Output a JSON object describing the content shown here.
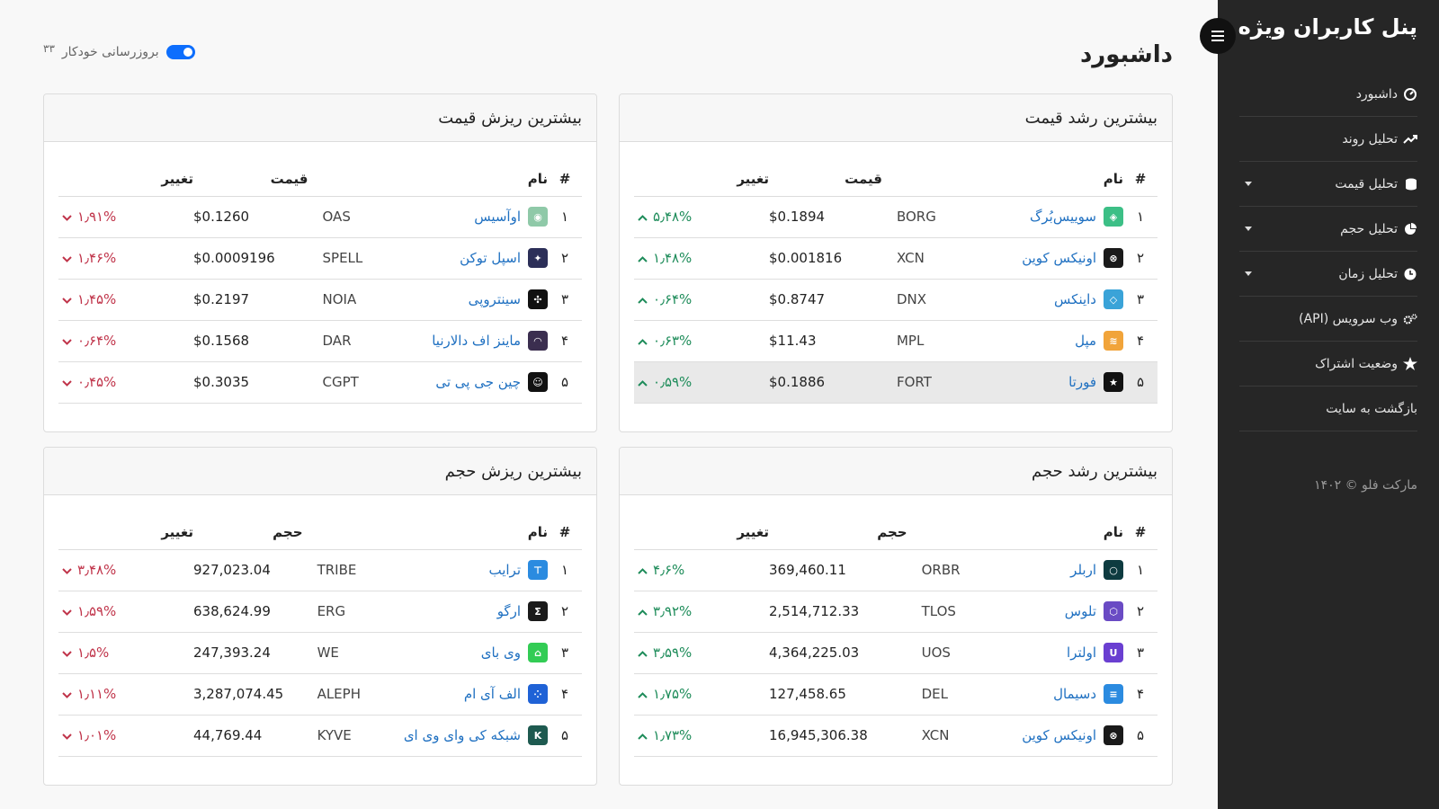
{
  "sidebar": {
    "title": "پنل کاربران ویژه",
    "items": [
      {
        "label": "داشبورد",
        "icon": "dashboard-icon",
        "caret": false
      },
      {
        "label": "تحلیل روند",
        "icon": "trend-icon",
        "caret": false
      },
      {
        "label": "تحلیل قیمت",
        "icon": "coins-icon",
        "caret": true
      },
      {
        "label": "تحلیل حجم",
        "icon": "pie-chart-icon",
        "caret": true
      },
      {
        "label": "تحلیل زمان",
        "icon": "clock-icon",
        "caret": true
      },
      {
        "label": "وب سرویس (API)",
        "icon": "gears-icon",
        "caret": false
      },
      {
        "label": "وضعیت اشتراک",
        "icon": "star-icon",
        "caret": false
      },
      {
        "label": "بازگشت به سایت",
        "icon": "",
        "caret": false
      }
    ],
    "copyright": "مارکت فلو © ۱۴۰۲"
  },
  "header": {
    "title": "داشبورد",
    "auto_refresh_label": "بروزرسانی خودکار",
    "auto_refresh_count": "۳۳",
    "auto_refresh_on": true
  },
  "cards": {
    "price_gainers": {
      "title": "بیشترین رشد قیمت",
      "headers": {
        "idx": "#",
        "name": "نام",
        "value": "قیمت",
        "change": "تغییر"
      },
      "rows": [
        {
          "idx": "۱",
          "name": "سوییس‌بُرگ",
          "symbol": "BORG",
          "value": "$0.1894",
          "change": "۵٫۴۸%",
          "icon_color": "#3cbf86",
          "icon_glyph": "◈"
        },
        {
          "idx": "۲",
          "name": "اونیکس کوین",
          "symbol": "XCN",
          "value": "$0.001816",
          "change": "۱٫۴۸%",
          "icon_color": "#1a1a1a",
          "icon_glyph": "⊗"
        },
        {
          "idx": "۳",
          "name": "داینکس",
          "symbol": "DNX",
          "value": "$0.8747",
          "change": "۰٫۶۴%",
          "icon_color": "#3aa3d8",
          "icon_glyph": "◇"
        },
        {
          "idx": "۴",
          "name": "مپل",
          "symbol": "MPL",
          "value": "$11.43",
          "change": "۰٫۶۳%",
          "icon_color": "#f1a43a",
          "icon_glyph": "≋"
        },
        {
          "idx": "۵",
          "name": "فورتا",
          "symbol": "FORT",
          "value": "$0.1886",
          "change": "۰٫۵۹%",
          "icon_color": "#111111",
          "icon_glyph": "★"
        }
      ]
    },
    "price_losers": {
      "title": "بیشترین ریزش قیمت",
      "headers": {
        "idx": "#",
        "name": "نام",
        "value": "قیمت",
        "change": "تغییر"
      },
      "rows": [
        {
          "idx": "۱",
          "name": "اوآسیس",
          "symbol": "OAS",
          "value": "$0.1260",
          "change": "۱٫۹۱%",
          "icon_color": "#8fc9a8",
          "icon_glyph": "◉"
        },
        {
          "idx": "۲",
          "name": "اسپل توکن",
          "symbol": "SPELL",
          "value": "$0.0009196",
          "change": "۱٫۴۶%",
          "icon_color": "#2c2f58",
          "icon_glyph": "✦"
        },
        {
          "idx": "۳",
          "name": "سینتروپی",
          "symbol": "NOIA",
          "value": "$0.2197",
          "change": "۱٫۴۵%",
          "icon_color": "#111111",
          "icon_glyph": "✣"
        },
        {
          "idx": "۴",
          "name": "ماینز اف دالارنیا",
          "symbol": "DAR",
          "value": "$0.1568",
          "change": "۰٫۶۴%",
          "icon_color": "#3b2e4f",
          "icon_glyph": "◠"
        },
        {
          "idx": "۵",
          "name": "چین جی پی تی",
          "symbol": "CGPT",
          "value": "$0.3035",
          "change": "۰٫۴۵%",
          "icon_color": "#111111",
          "icon_glyph": "☺"
        }
      ]
    },
    "volume_gainers": {
      "title": "بیشترین رشد حجم",
      "headers": {
        "idx": "#",
        "name": "نام",
        "value": "حجم",
        "change": "تغییر"
      },
      "rows": [
        {
          "idx": "۱",
          "name": "اربلر",
          "symbol": "ORBR",
          "value": "369,460.11",
          "change": "۴٫۶%",
          "icon_color": "#0e3b40",
          "icon_glyph": "○"
        },
        {
          "idx": "۲",
          "name": "تلوس",
          "symbol": "TLOS",
          "value": "2,514,712.33",
          "change": "۳٫۹۲%",
          "icon_color": "#6a4bc4",
          "icon_glyph": "⬡"
        },
        {
          "idx": "۳",
          "name": "اولترا",
          "symbol": "UOS",
          "value": "4,364,225.03",
          "change": "۳٫۵۹%",
          "icon_color": "#6a3fd1",
          "icon_glyph": "U"
        },
        {
          "idx": "۴",
          "name": "دسیمال",
          "symbol": "DEL",
          "value": "127,458.65",
          "change": "۱٫۷۵%",
          "icon_color": "#2b8be0",
          "icon_glyph": "≡"
        },
        {
          "idx": "۵",
          "name": "اونیکس کوین",
          "symbol": "XCN",
          "value": "16,945,306.38",
          "change": "۱٫۷۳%",
          "icon_color": "#1a1a1a",
          "icon_glyph": "⊗"
        }
      ]
    },
    "volume_losers": {
      "title": "بیشترین ریزش حجم",
      "headers": {
        "idx": "#",
        "name": "نام",
        "value": "حجم",
        "change": "تغییر"
      },
      "rows": [
        {
          "idx": "۱",
          "name": "ترایب",
          "symbol": "TRIBE",
          "value": "927,023.04",
          "change": "۳٫۴۸%",
          "icon_color": "#2b8be0",
          "icon_glyph": "⊤"
        },
        {
          "idx": "۲",
          "name": "ارگو",
          "symbol": "ERG",
          "value": "638,624.99",
          "change": "۱٫۵۹%",
          "icon_color": "#1a1a1a",
          "icon_glyph": "Σ"
        },
        {
          "idx": "۳",
          "name": "وی بای",
          "symbol": "WE",
          "value": "247,393.24",
          "change": "۱٫۵%",
          "icon_color": "#33cc55",
          "icon_glyph": "⌂"
        },
        {
          "idx": "۴",
          "name": "الف آی ام",
          "symbol": "ALEPH",
          "value": "3,287,074.45",
          "change": "۱٫۱۱%",
          "icon_color": "#1f62d6",
          "icon_glyph": "⁘"
        },
        {
          "idx": "۵",
          "name": "شبکه کی وای وی ای",
          "symbol": "KYVE",
          "value": "44,769.44",
          "change": "۱٫۰۱%",
          "icon_color": "#1e5a50",
          "icon_glyph": "K"
        }
      ]
    }
  }
}
